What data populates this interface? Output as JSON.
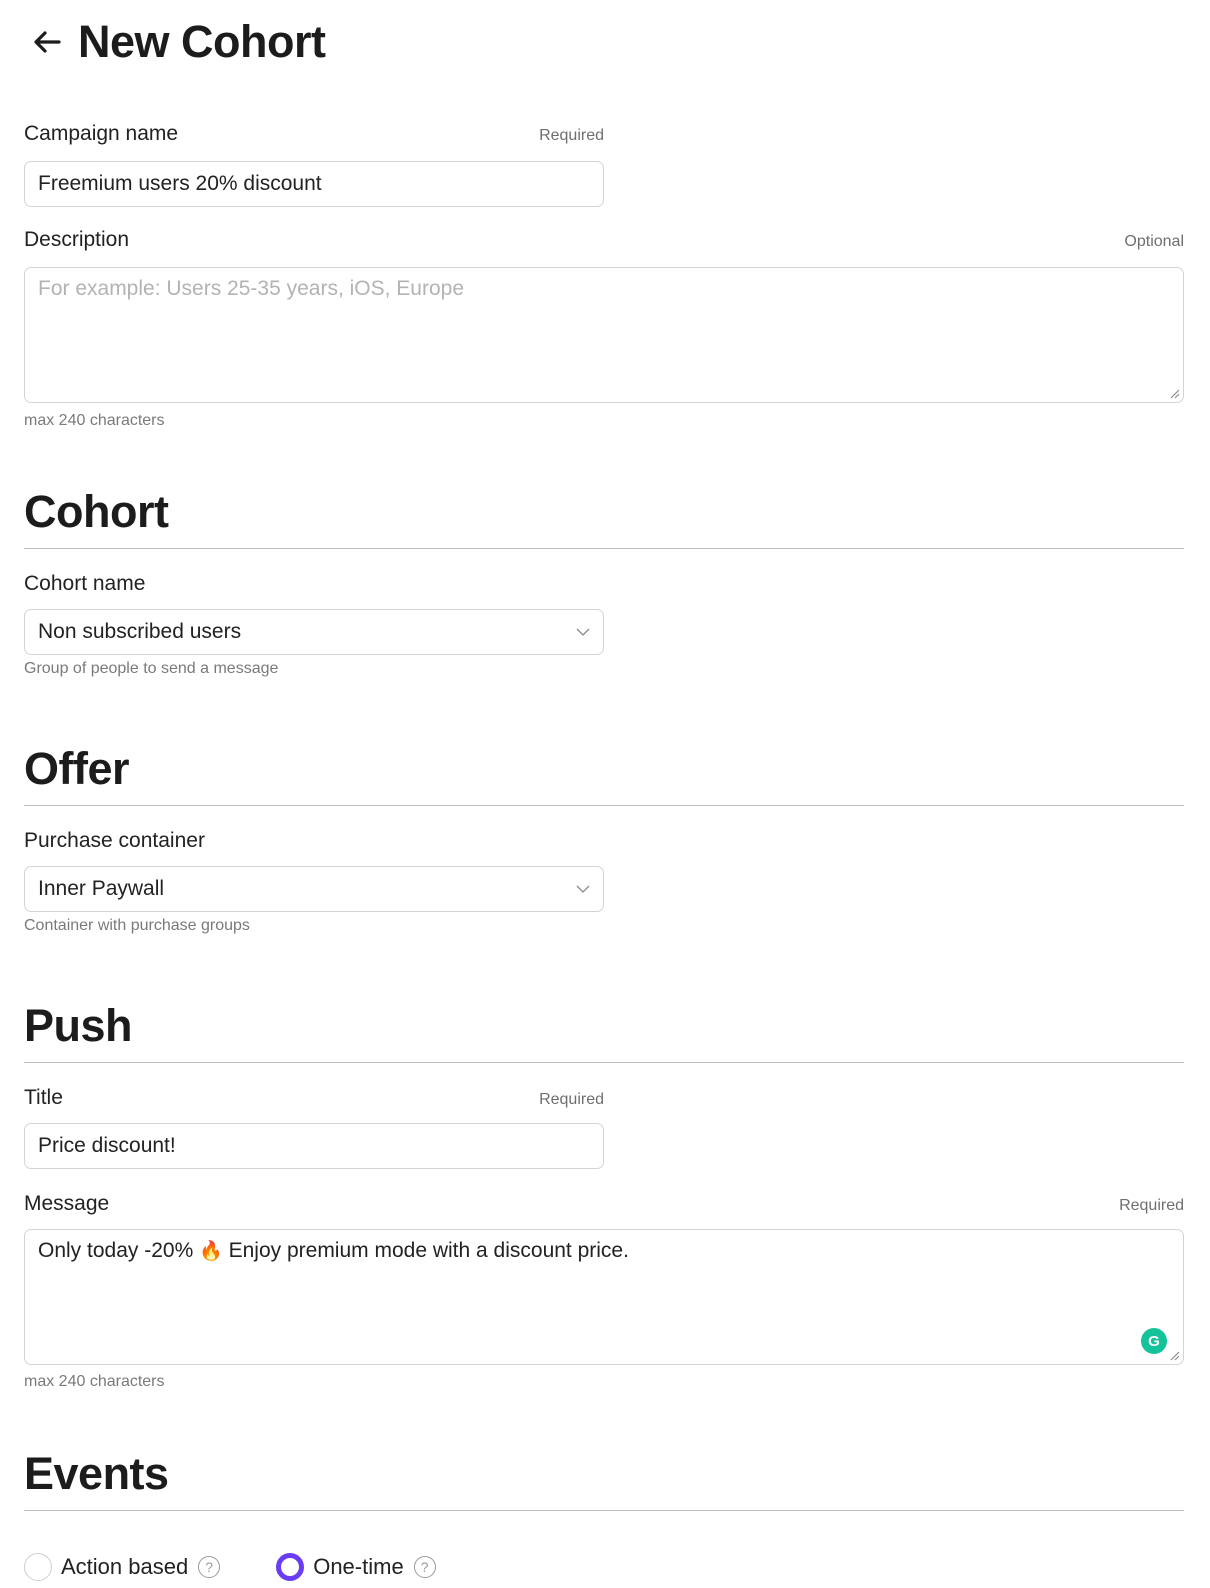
{
  "header": {
    "title": "New Cohort"
  },
  "campaign": {
    "label": "Campaign name",
    "tag": "Required",
    "value": "Freemium users 20% discount"
  },
  "description": {
    "label": "Description",
    "tag": "Optional",
    "placeholder": "For example: Users 25-35 years, iOS, Europe",
    "hint": "max 240 characters"
  },
  "cohort": {
    "section_title": "Cohort",
    "label": "Cohort name",
    "value": "Non subscribed users",
    "hint": "Group of people to send a message"
  },
  "offer": {
    "section_title": "Offer",
    "label": "Purchase container",
    "value": "Inner Paywall",
    "hint": "Container with purchase groups"
  },
  "push": {
    "section_title": "Push",
    "title_label": "Title",
    "title_tag": "Required",
    "title_value": "Price discount!",
    "message_label": "Message",
    "message_tag": "Required",
    "message_before": "Only today -20% ",
    "message_emoji": "🔥",
    "message_after": " Enjoy premium mode with a discount price.",
    "message_hint": "max 240 characters",
    "grammarly_letter": "G"
  },
  "events": {
    "section_title": "Events",
    "options": [
      {
        "label": "Action based",
        "selected": false
      },
      {
        "label": "One-time",
        "selected": true
      }
    ],
    "help_glyph": "?"
  },
  "colors": {
    "accent": "#6a3cf3",
    "grammarly": "#15c39a",
    "fire": "#f26b1d"
  },
  "icons": {
    "back": "arrow-left-icon",
    "select": "chevron-down-icon",
    "help": "question-circle-icon"
  }
}
